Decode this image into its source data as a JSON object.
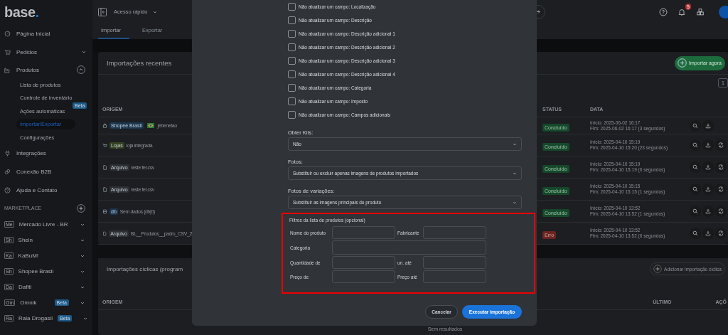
{
  "sidebar": {
    "logo": {
      "text": "base",
      "accent": "."
    },
    "nav": [
      {
        "label": "Página Inicial"
      },
      {
        "label": "Pedidos",
        "expanded": false
      },
      {
        "label": "Produtos",
        "expanded": true,
        "children": [
          {
            "label": "Lista de produtos",
            "selected": false
          },
          {
            "label": "Controle de inventário",
            "selected": false
          },
          {
            "label": "Ações automáticas",
            "selected": false,
            "badge": "Beta"
          },
          {
            "label": "Importar/Exportar",
            "selected": true
          },
          {
            "label": "Configurações",
            "selected": false
          }
        ]
      },
      {
        "label": "Integrações"
      },
      {
        "label": "Conexão B2B"
      },
      {
        "label": "Ajuda e Contato"
      }
    ],
    "marketplace": {
      "title": "MARKETPLACE",
      "items": [
        {
          "abbr": "Me",
          "label": "Mercado Livre - BR"
        },
        {
          "abbr": "Sh",
          "label": "Shein"
        },
        {
          "abbr": "Ka",
          "label": "KaBuM!"
        },
        {
          "abbr": "Sh",
          "label": "Shopee Brasil"
        },
        {
          "abbr": "Da",
          "label": "Dafiti"
        },
        {
          "abbr": "Om",
          "label": "Omnik",
          "badge": "Beta"
        },
        {
          "abbr": "Ra",
          "label": "Raia Drogasil",
          "badge": "Beta"
        }
      ]
    }
  },
  "topbar": {
    "quick_access": "Acesso rápido",
    "notification_count": "5"
  },
  "tabs": [
    {
      "label": "Importar",
      "selected": true
    },
    {
      "label": "Exportar",
      "selected": false
    }
  ],
  "recent_imports": {
    "title": "Importações recentes",
    "button": "Importar agora",
    "page": "1",
    "columns": [
      "ORIGEM",
      "STATUS",
      "DATA"
    ],
    "rows": [
      {
        "kind": "shopee",
        "tag": "Shopee Brasil",
        "flag": true,
        "name": "jebenetao",
        "status": {
          "label": "Concluído",
          "kind": "success"
        },
        "start": "Início: 2025-06-02 16:17",
        "end": "Fim: 2025-06-02 16:17 (3 segundos)",
        "repeatable": false
      },
      {
        "kind": "store",
        "tag": "Lojas",
        "flag": false,
        "name": "loja integrada",
        "status": {
          "label": "Concluído",
          "kind": "success"
        },
        "start": "Início: 2025-04-10 15:19",
        "end": "Fim: 2025-04-10 15:20 (23 segundos)",
        "repeatable": true
      },
      {
        "kind": "file",
        "tag": "Arquivo",
        "flag": false,
        "name": "teste fer.csv",
        "status": {
          "label": "Concluído",
          "kind": "success"
        },
        "start": "Início: 2025-04-10 15:19",
        "end": "Fim: 2025-04-10 15:19 (0 segundos)",
        "repeatable": true
      },
      {
        "kind": "file",
        "tag": "Arquivo",
        "flag": false,
        "name": "teste fer.csv",
        "status": {
          "label": "Concluído",
          "kind": "success"
        },
        "start": "Início: 2025-04-10 15:15",
        "end": "Fim: 2025-04-10 15:15 (1 segundos)",
        "repeatable": true
      },
      {
        "kind": "db",
        "tag": "db",
        "flag": false,
        "name": "Sem dados (db|0)",
        "status": {
          "label": "Concluído",
          "kind": "success"
        },
        "start": "Início: 2025-04-10 13:52",
        "end": "Fim: 2025-04-10 13:52 (1 segundos)",
        "repeatable": true
      },
      {
        "kind": "file",
        "tag": "Arquivo",
        "flag": false,
        "name": "BL__Produtos__padro_CSV_2",
        "status": {
          "label": "Erro",
          "kind": "error"
        },
        "start": "Início: 2025-04-10 13:52",
        "end": "Fim: 2025-04-10 13:52 (0 segundos)",
        "repeatable": true
      }
    ]
  },
  "cyclic_imports": {
    "title": "Importações cíclicas (program",
    "button": "Adicionar importação cíclica",
    "columns": [
      "ORIGEM",
      "ÚLTIMO",
      "AÇÕ"
    ],
    "empty": "Sem resultados"
  },
  "modal": {
    "checkboxes": [
      {
        "label": "Não atualizar um campo: Localização",
        "checked": false
      },
      {
        "label": "Não atualizar um campo: Descrição",
        "checked": false
      },
      {
        "label": "Não atualizar um campo: Descrição adicional 1",
        "checked": false
      },
      {
        "label": "Não atualizar um campo: Descrição adicional 2",
        "checked": false
      },
      {
        "label": "Não atualizar um campo: Descrição adicional 3",
        "checked": false
      },
      {
        "label": "Não atualizar um campo: Descrição adicional 4",
        "checked": false
      },
      {
        "label": "Não atualizar um campo: Categoria",
        "checked": false
      },
      {
        "label": "Não atualizar um campo: Imposto",
        "checked": false
      },
      {
        "label": "Não atualizar um campo: Campos adicionais",
        "checked": false
      }
    ],
    "selects": [
      {
        "label": "Obter Kits:",
        "value": "Não"
      },
      {
        "label": "Fotos:",
        "value": "Substituir ou excluir apenas imagens de produtos importados"
      },
      {
        "label": "Fotos de variações:",
        "value": "Substituir as imagens principais do produto"
      }
    ],
    "filters": {
      "title": "Filtros da lista de produtos (opcional)",
      "rows": [
        {
          "fields": [
            {
              "label": "Nome do produto"
            },
            {
              "label": "Fabricante"
            }
          ]
        },
        {
          "fields": [
            {
              "label": "Categoria"
            }
          ]
        },
        {
          "fields": [
            {
              "label": "Quantidade de"
            },
            {
              "label": "un. até"
            }
          ]
        },
        {
          "fields": [
            {
              "label": "Preço de"
            },
            {
              "label": "Preço até"
            }
          ]
        }
      ]
    },
    "buttons": [
      {
        "label": "Cancelar",
        "kind": "secondary"
      },
      {
        "label": "Executar importação",
        "kind": "primary"
      }
    ]
  }
}
